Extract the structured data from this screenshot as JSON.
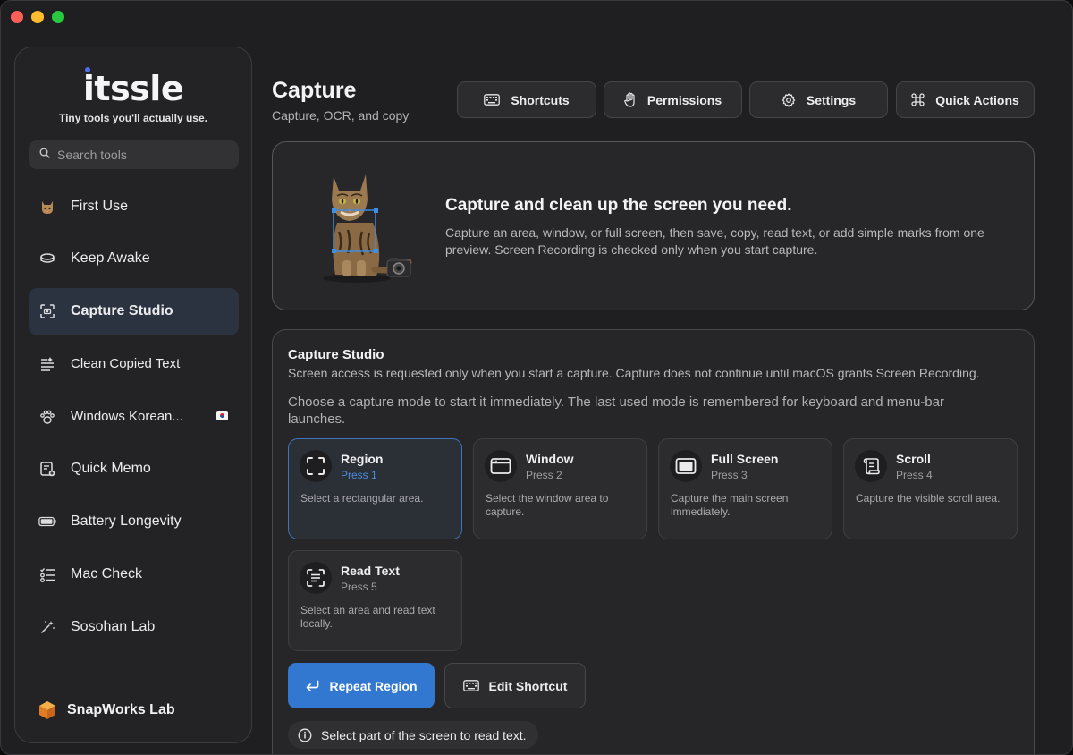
{
  "app": {
    "logo_text": "itssle",
    "tagline": "Tiny tools you'll actually use."
  },
  "sidebar": {
    "search_placeholder": "Search tools",
    "items": [
      {
        "label": "First Use",
        "icon": "cat-icon"
      },
      {
        "label": "Keep Awake",
        "icon": "cup-icon"
      },
      {
        "label": "Capture Studio",
        "icon": "capture-icon",
        "active": true
      },
      {
        "label": "Clean Copied Text",
        "icon": "text-clean-icon"
      },
      {
        "label": "Windows Korean...",
        "icon": "paw-icon",
        "badge": "korea-flag-icon"
      },
      {
        "label": "Quick Memo",
        "icon": "memo-icon"
      },
      {
        "label": "Battery Longevity",
        "icon": "battery-icon"
      },
      {
        "label": "Mac Check",
        "icon": "checklist-icon"
      },
      {
        "label": "Sosohan Lab",
        "icon": "sparkle-icon"
      }
    ],
    "brand": "SnapWorks Lab"
  },
  "header": {
    "title": "Capture",
    "subtitle": "Capture, OCR, and copy",
    "buttons": [
      {
        "label": "Shortcuts",
        "icon": "keyboard-icon"
      },
      {
        "label": "Permissions",
        "icon": "hand-icon"
      },
      {
        "label": "Settings",
        "icon": "gear-icon"
      },
      {
        "label": "Quick Actions",
        "icon": "command-icon"
      }
    ]
  },
  "hero": {
    "title": "Capture and clean up the screen you need.",
    "description": "Capture an area, window, or full screen, then save, copy, read text, or add simple marks from one preview. Screen Recording is checked only when you start capture."
  },
  "studio": {
    "title": "Capture Studio",
    "note": "Screen access is requested only when you start a capture. Capture does not continue until macOS grants Screen Recording.",
    "description": "Choose a capture mode to start it immediately. The last used mode is remembered for keyboard and menu-bar launches.",
    "modes": [
      {
        "title": "Region",
        "key": "Press 1",
        "description": "Select a rectangular area.",
        "icon": "region-icon",
        "selected": true
      },
      {
        "title": "Window",
        "key": "Press 2",
        "description": "Select the window area to capture.",
        "icon": "window-icon"
      },
      {
        "title": "Full Screen",
        "key": "Press 3",
        "description": "Capture the main screen immediately.",
        "icon": "full-screen-icon"
      },
      {
        "title": "Scroll",
        "key": "Press 4",
        "description": "Capture the visible scroll area.",
        "icon": "scroll-icon"
      },
      {
        "title": "Read Text",
        "key": "Press 5",
        "description": "Select an area and read text locally.",
        "icon": "read-text-icon"
      }
    ],
    "repeat_button": "Repeat Region",
    "edit_shortcut_button": "Edit Shortcut",
    "info": "Select part of the screen to read text."
  },
  "colors": {
    "accent": "#3278d0",
    "selected_border": "#3e75b8",
    "logo_dot": "#4f6cf0"
  }
}
